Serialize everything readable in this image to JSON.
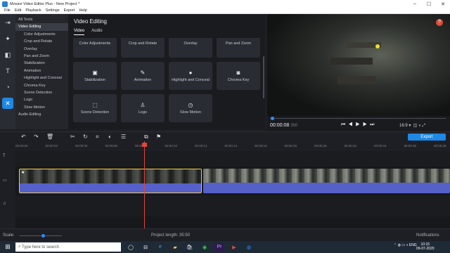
{
  "window": {
    "title": "Movavi Video Editor Plus - New Project *"
  },
  "menu": [
    "File",
    "Edit",
    "Playback",
    "Settings",
    "Export",
    "Help"
  ],
  "tools": {
    "items": [
      {
        "label": "All Tools",
        "group": true
      },
      {
        "label": "Video Editing",
        "group": true,
        "selected": true
      },
      {
        "label": "Color Adjustments"
      },
      {
        "label": "Crop and Rotate"
      },
      {
        "label": "Overlay"
      },
      {
        "label": "Pan and Zoom"
      },
      {
        "label": "Stabilization"
      },
      {
        "label": "Animation"
      },
      {
        "label": "Highlight and Conceal"
      },
      {
        "label": "Chroma Key"
      },
      {
        "label": "Scene Detection"
      },
      {
        "label": "Logo"
      },
      {
        "label": "Slow Motion"
      },
      {
        "label": "Audio Editing",
        "group": true
      }
    ]
  },
  "panel": {
    "title": "Video Editing",
    "tabs": [
      "Video",
      "Audio"
    ],
    "tiles": [
      {
        "label": "Color Adjustments",
        "icon": "color-icon"
      },
      {
        "label": "Crop and Rotate",
        "icon": "crop-icon"
      },
      {
        "label": "Overlay",
        "icon": "overlay-icon"
      },
      {
        "label": "Pan and Zoom",
        "icon": "zoom-icon"
      },
      {
        "label": "Stabilization",
        "icon": "stabilization-icon"
      },
      {
        "label": "Animation",
        "icon": "animation-icon"
      },
      {
        "label": "Highlight and Conceal",
        "icon": "highlight-icon"
      },
      {
        "label": "Chroma Key",
        "icon": "chroma-key-icon"
      },
      {
        "label": "Scene Detection",
        "icon": "scene-detection-icon"
      },
      {
        "label": "Logo",
        "icon": "logo-icon"
      },
      {
        "label": "Slow Motion",
        "icon": "slow-motion-icon"
      }
    ]
  },
  "player": {
    "timecode": "00:00:08",
    "timecode_frames": "390",
    "aspect": "16:9",
    "help": "?",
    "progress": 0.01
  },
  "timeline": {
    "export_label": "Export",
    "ticks": [
      "00:00:00",
      "00:00:02",
      "00:00:04",
      "00:00:06",
      "00:00:08",
      "00:00:10",
      "00:00:12",
      "00:00:14",
      "00:00:16",
      "00:00:18",
      "00:00:20",
      "00:00:22",
      "00:00:24",
      "00:00:26",
      "00:00:28"
    ]
  },
  "status": {
    "scale_label": "Scale:",
    "project_length": "Project length: 35:50",
    "notifications": "Notifications"
  },
  "taskbar": {
    "search_placeholder": "Type here to search",
    "lang": "ENG",
    "time": "10:15",
    "date": "09-07-2020"
  }
}
